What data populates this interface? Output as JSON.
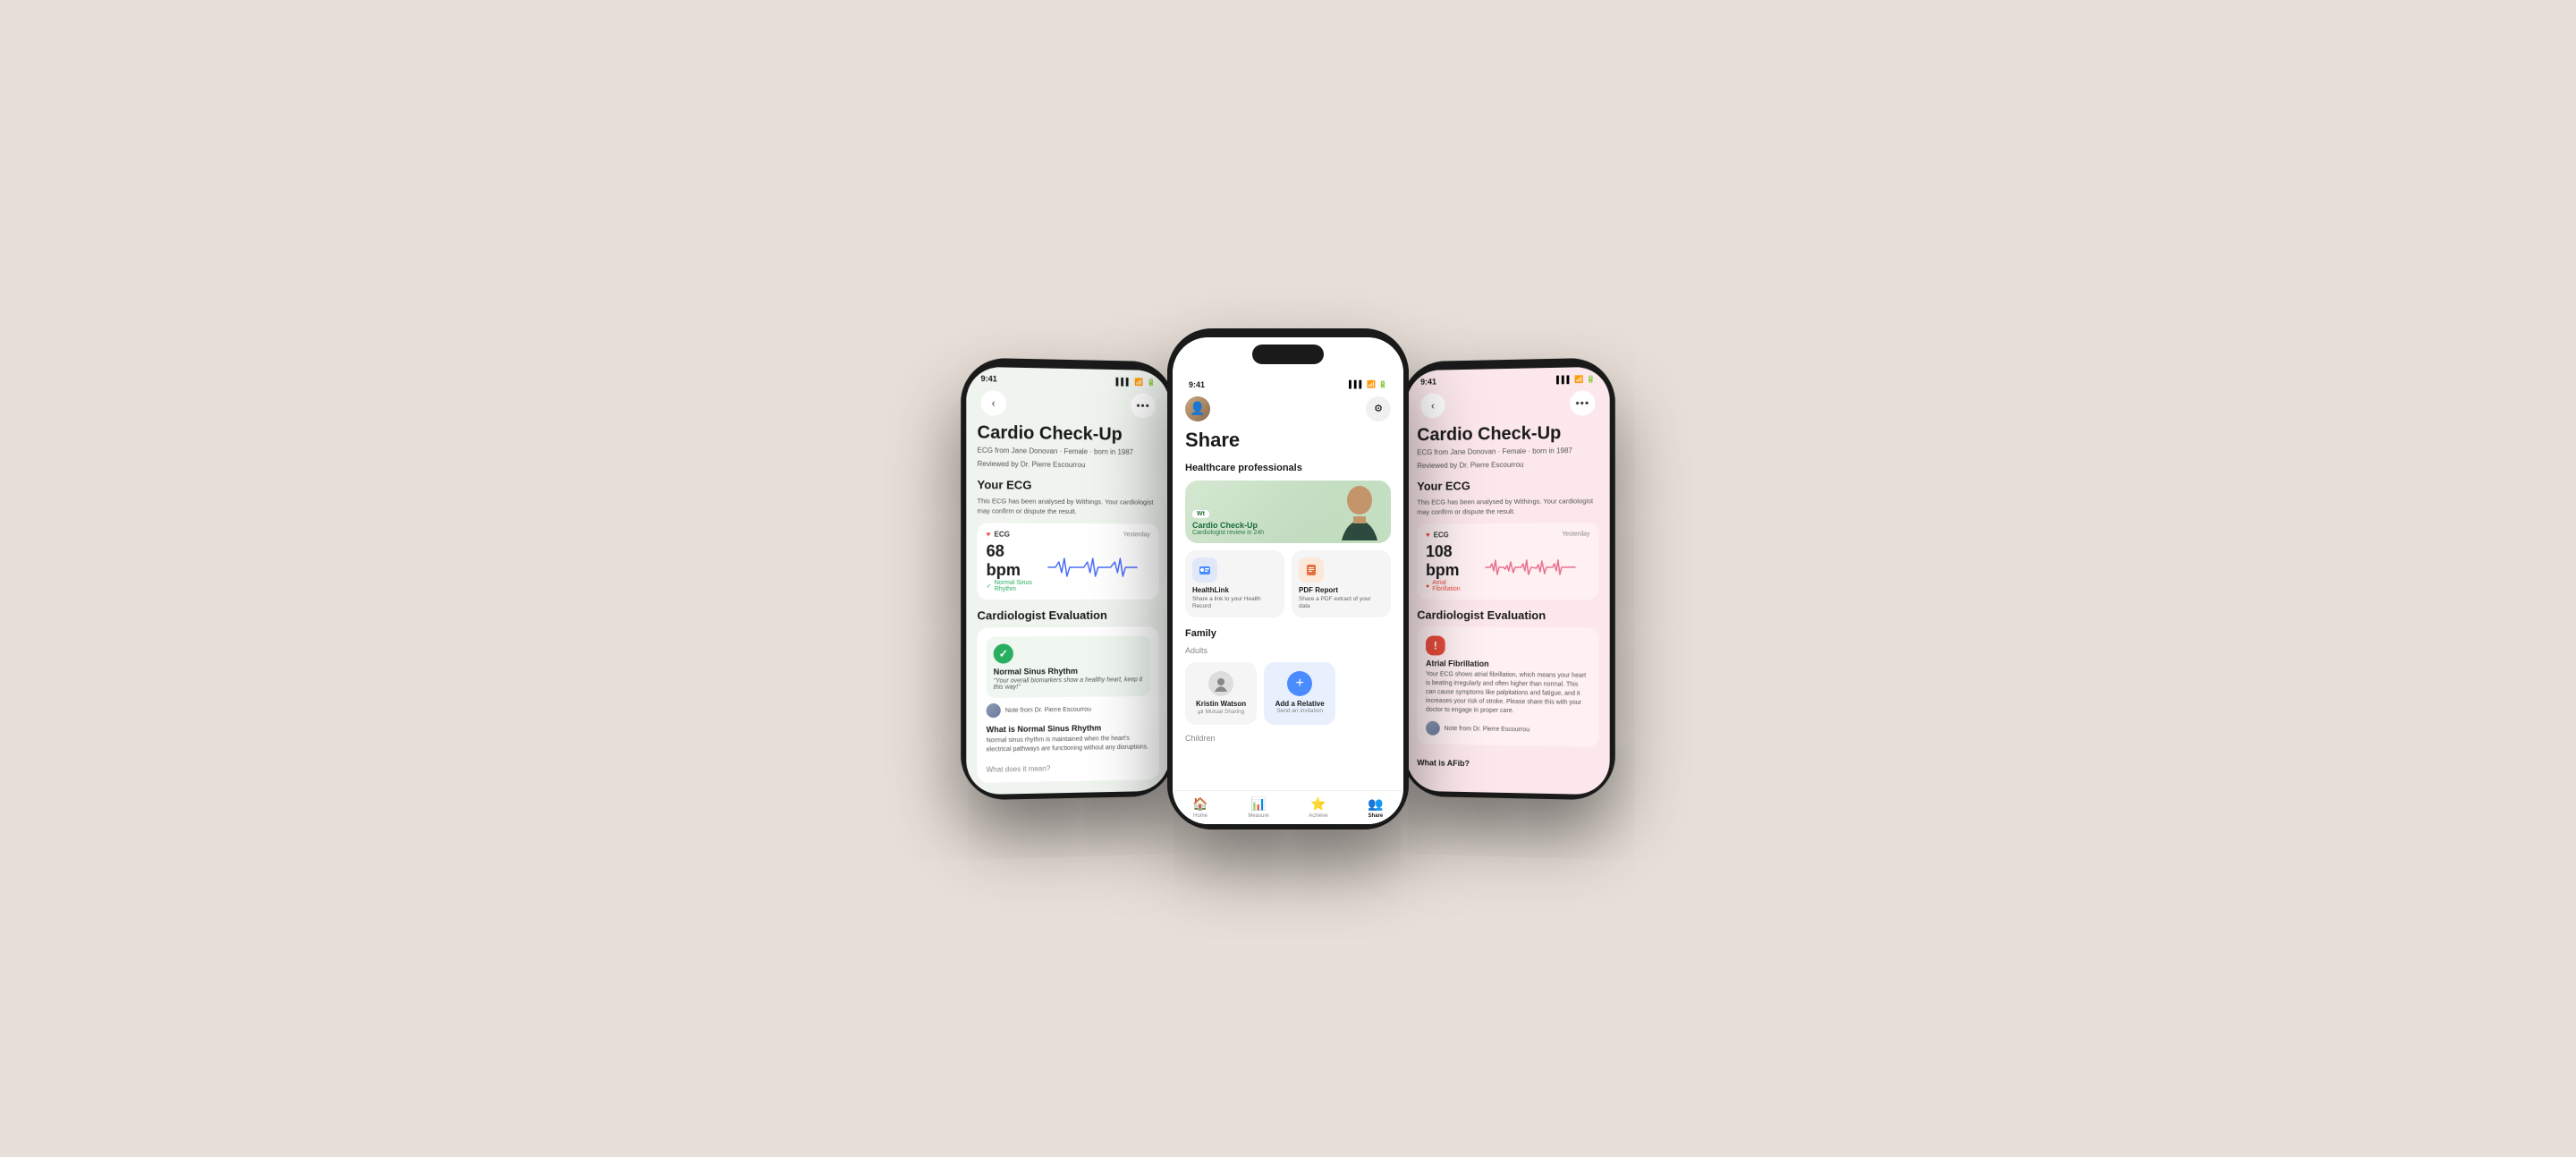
{
  "background": "#e8e0d8",
  "phones": {
    "left": {
      "status_time": "9:41",
      "bg_color": "#edf4eb",
      "title": "Cardio Check-Up",
      "subtitle_line1": "ECG from Jane Donovan · Female · born in 1987",
      "subtitle_line2": "Reviewed by Dr. Pierre Escourrou",
      "ecg_section": "Your ECG",
      "ecg_desc": "This ECG has been analysed by Withings. Your cardiologist may confirm or dispute the result.",
      "ecg_label": "ECG",
      "ecg_time": "Yesterday",
      "ecg_bpm": "68 bpm",
      "ecg_rhythm": "Normal Sinus Rhythm",
      "cardiologist_section": "Cardiologist Evaluation",
      "diagnosis_name": "Normal Sinus Rhythm",
      "diagnosis_quote": "\"Your overall biomarkers show a healthy heart, keep it this way!\"",
      "doctor_note": "Note from Dr. Pierre Escourrou",
      "what_is_title": "What is Normal Sinus Rhythm",
      "what_is_text": "Normal sinus rhythm is maintained when the heart's electrical pathways are functioning without any disruptions.",
      "what_does_it_mean": "What does it mean?"
    },
    "center": {
      "status_time": "9:41",
      "bg_color": "#ffffff",
      "page_title": "Share",
      "professionals_title": "Healthcare professionals",
      "professional_card_badge": "Wt",
      "professional_card_title": "Cardio Check-Up",
      "professional_card_sub": "Cardiologist review in 24h",
      "tool1_title": "HealthLink",
      "tool1_desc": "Share a link to your Health Record",
      "tool2_title": "PDF Report",
      "tool2_desc": "Share a PDF extract of your data",
      "family_title": "Family",
      "adults_label": "Adults",
      "member_name": "Kristin Watson",
      "member_status": "Mutual Sharing",
      "add_relative_title": "Add a Relative",
      "add_relative_sub": "Send an invitation",
      "children_label": "Children",
      "tabs": [
        "Home",
        "Measure",
        "Achieve",
        "Share"
      ]
    },
    "right": {
      "status_time": "9:41",
      "bg_color": "#fce8ec",
      "title": "Cardio Check-Up",
      "subtitle_line1": "ECG from Jane Donovan · Female · born in 1987",
      "subtitle_line2": "Reviewed by Dr. Pierre Escourrou",
      "ecg_section": "Your ECG",
      "ecg_desc": "This ECG has been analysed by Withings. Your cardiologist may confirm or dispute the result.",
      "ecg_label": "ECG",
      "ecg_time": "Yesterday",
      "ecg_bpm": "108 bpm",
      "ecg_rhythm": "Atrial Fibrillation",
      "cardiologist_section": "Cardiologist Evaluation",
      "diagnosis_name": "Atrial Fibrillation",
      "diagnosis_text": "Your ECG shows atrial fibrillation, which means your heart is beating irregularly and often higher than normal. This can cause symptoms like palpitations and fatigue, and it increases your risk of stroke. Please share this with your doctor to engage in proper care.",
      "doctor_note": "Note from Dr. Pierre Escourrou",
      "what_is_title": "What is AFib?"
    }
  }
}
